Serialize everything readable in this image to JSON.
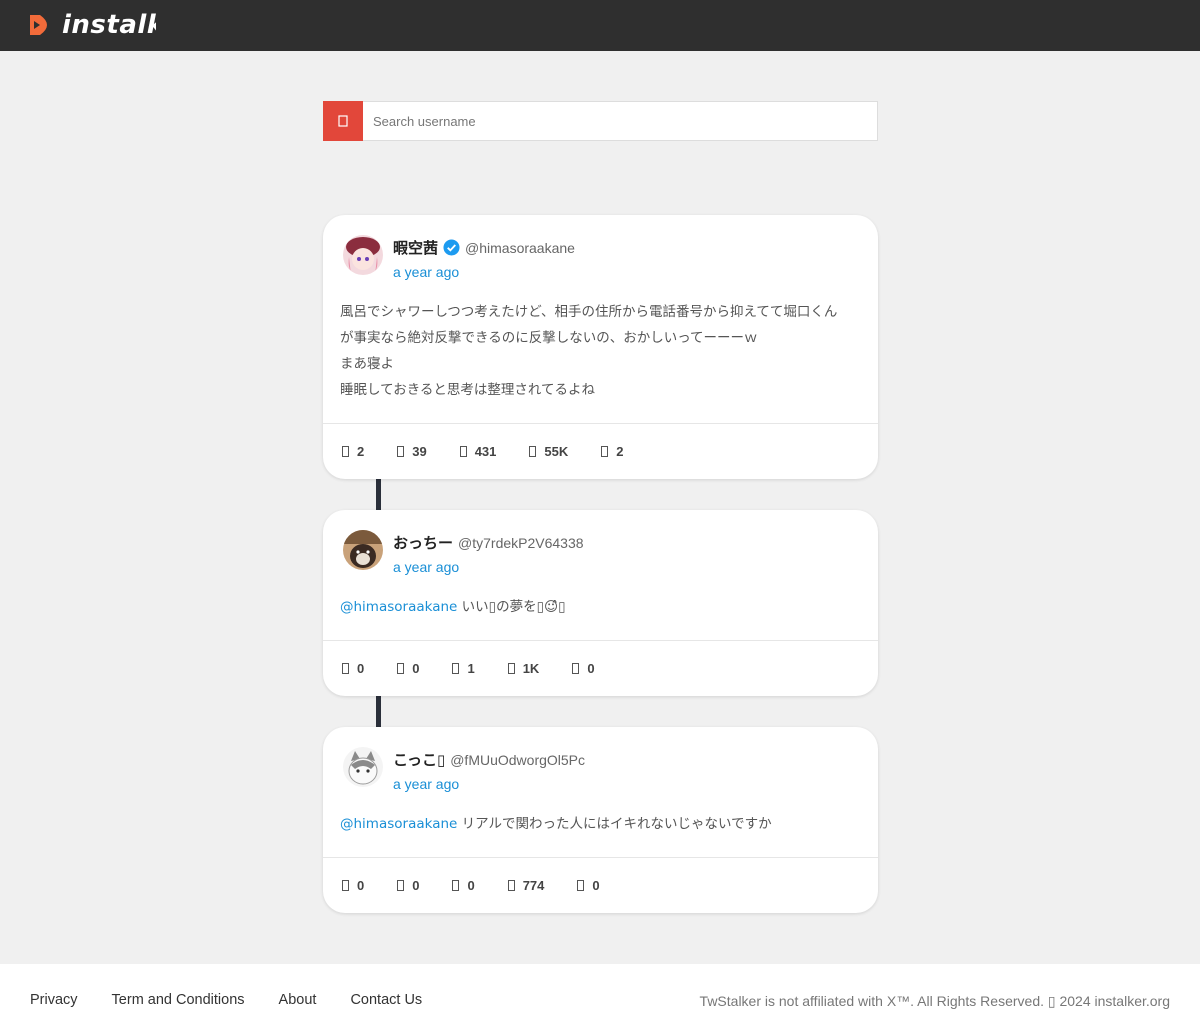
{
  "brand": {
    "name": "instalker",
    "color": "#f26b3a"
  },
  "search": {
    "placeholder": "Search username",
    "button_icon": "search-icon",
    "accent": "#e2473a"
  },
  "tweets": [
    {
      "display_name": "暇空茜",
      "verified": true,
      "handle": "@himasoraakane",
      "time": "a year ago",
      "lines": [
        "風呂でシャワーしつつ考えたけど、相手の住所から電話番号から抑えてて堀口くん",
        "が事実なら絶対反撃できるのに反撃しないの、おかしいってーーーｗ",
        "まあ寝よ",
        "睡眠しておきると思考は整理されてるよね"
      ],
      "stats": {
        "replies": "2",
        "retweets": "39",
        "likes": "431",
        "views": "55K",
        "bookmarks": "2"
      }
    },
    {
      "display_name": "おっちー",
      "verified": false,
      "handle": "@ty7rdekP2V64338",
      "time": "a year ago",
      "mention": "@himasoraakane",
      "text": " いい▯の夢を▯☺̂̂▯",
      "stats": {
        "replies": "0",
        "retweets": "0",
        "likes": "1",
        "views": "1K",
        "bookmarks": "0"
      }
    },
    {
      "display_name": "こっこ▯",
      "verified": false,
      "handle": "@fMUuOdworgOl5Pc",
      "time": "a year ago",
      "mention": "@himasoraakane",
      "text": " リアルで関わった人にはイキれないじゃないですか",
      "stats": {
        "replies": "0",
        "retweets": "0",
        "likes": "0",
        "views": "774",
        "bookmarks": "0"
      }
    }
  ],
  "footer": {
    "links": [
      "Privacy",
      "Term and Conditions",
      "About",
      "Contact Us"
    ],
    "copyright": "TwStalker is not affiliated with X™. All Rights Reserved. ▯ 2024 instalker.org"
  }
}
